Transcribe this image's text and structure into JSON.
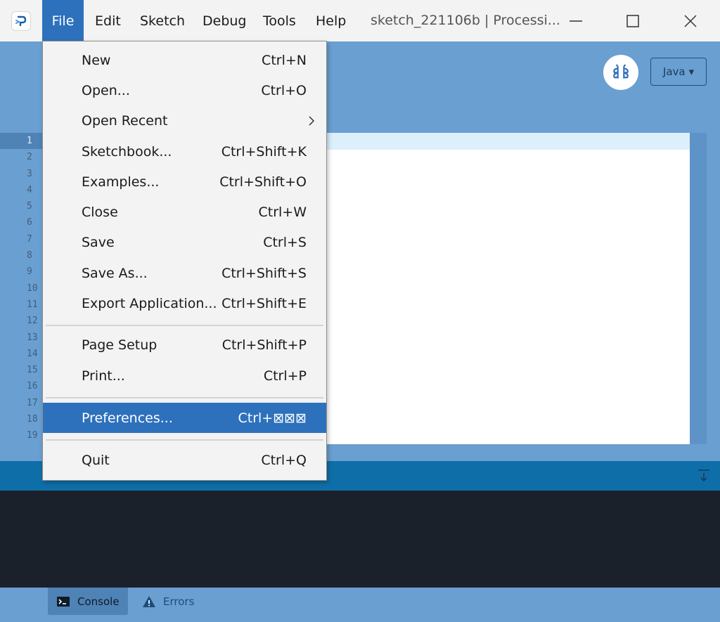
{
  "menubar": {
    "items": [
      "File",
      "Edit",
      "Sketch",
      "Debug",
      "Tools",
      "Help"
    ],
    "active": "File",
    "window_title": "sketch_221106b | Processi..."
  },
  "toolbar": {
    "mode_label": "Java",
    "mode_arrow": "▾",
    "mode_icon": "debugger-butterfly-icon"
  },
  "editor": {
    "line_numbers": [
      "1",
      "2",
      "3",
      "4",
      "5",
      "6",
      "7",
      "8",
      "9",
      "10",
      "11",
      "12",
      "13",
      "14",
      "15",
      "16",
      "17",
      "18",
      "19"
    ],
    "current_line": 1
  },
  "file_menu": {
    "items": [
      {
        "label": "New",
        "shortcut": "Ctrl+N"
      },
      {
        "label": "Open...",
        "shortcut": "Ctrl+O"
      },
      {
        "label": "Open Recent",
        "shortcut": "",
        "submenu": true
      },
      {
        "label": "Sketchbook...",
        "shortcut": "Ctrl+Shift+K"
      },
      {
        "label": "Examples...",
        "shortcut": "Ctrl+Shift+O"
      },
      {
        "label": "Close",
        "shortcut": "Ctrl+W"
      },
      {
        "label": "Save",
        "shortcut": "Ctrl+S"
      },
      {
        "label": "Save As...",
        "shortcut": "Ctrl+Shift+S"
      },
      {
        "label": "Export Application...",
        "shortcut": "Ctrl+Shift+E"
      },
      {
        "label": "Page Setup",
        "shortcut": "Ctrl+Shift+P"
      },
      {
        "label": "Print...",
        "shortcut": "Ctrl+P"
      },
      {
        "label": "Preferences...",
        "shortcut": "Ctrl+⊠⊠⊠",
        "highlighted": true
      },
      {
        "label": "Quit",
        "shortcut": "Ctrl+Q"
      }
    ]
  },
  "footer": {
    "tabs": [
      {
        "label": "Console",
        "icon": "terminal-icon",
        "active": true
      },
      {
        "label": "Errors",
        "icon": "warning-icon",
        "active": false
      }
    ]
  },
  "colors": {
    "accent": "#2d71bd",
    "background": "#6a9fd1",
    "console_bg": "#1b212a",
    "console_header": "#0e6fa8"
  }
}
